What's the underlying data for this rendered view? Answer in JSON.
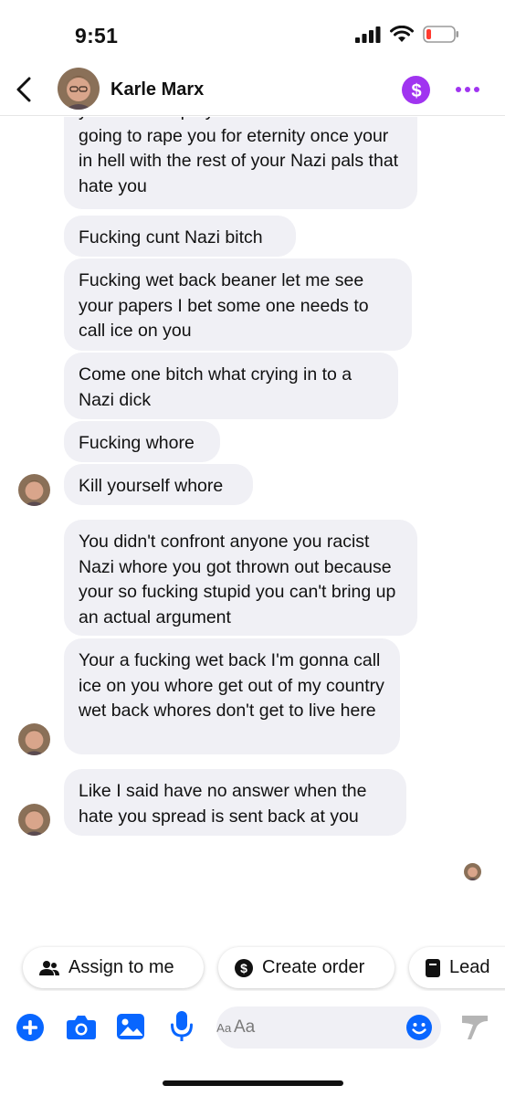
{
  "status_bar": {
    "time": "9:51"
  },
  "header": {
    "contact_name": "Karle Marx",
    "pay_icon": "dollar-icon",
    "accent_color": "#a034f0"
  },
  "messages": [
    {
      "text": "your self I hope you like it cause Satan is going to rape you for eternity once your in hell with the rest of your Nazi pals that hate you"
    },
    {
      "text": "Fucking cunt Nazi bitch"
    },
    {
      "text": "Fucking wet back beaner let me see your papers I bet some one needs to call ice on you"
    },
    {
      "text": "Come one bitch what crying in to a Nazi dick"
    },
    {
      "text": "Fucking whore"
    },
    {
      "text": "Kill yourself whore"
    },
    {
      "text": "You didn't confront anyone you racist Nazi whore you got thrown out because your so fucking stupid you can't bring up an actual argument"
    },
    {
      "text": "Your a fucking wet back I'm gonna call ice on you whore get out of my country wet back whores don't get to live here"
    },
    {
      "text": "Like I said have no answer when the hate you spread is sent back at you"
    }
  ],
  "quick_actions": [
    {
      "label": "Assign to me",
      "icon": "people-icon"
    },
    {
      "label": "Create order",
      "icon": "dollar-circle-icon"
    },
    {
      "label": "Lead",
      "icon": "notebook-icon"
    }
  ],
  "composer": {
    "placeholder": "Aa",
    "icon_color": "#0866ff"
  }
}
